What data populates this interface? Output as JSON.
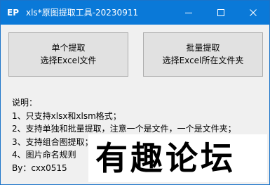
{
  "window": {
    "app_icon_text": "EP",
    "title": "xls*原图提取工具-20230911",
    "controls": {
      "minimize_icon": "minimize-icon",
      "maximize_icon": "maximize-icon",
      "close_icon": "close-icon"
    },
    "accent_color": "#0a79d8"
  },
  "buttons": {
    "single": {
      "line1": "单个提取",
      "line2": "选择Excel文件"
    },
    "batch": {
      "line1": "批量提取",
      "line2": "选择Excel所在文件夹"
    }
  },
  "instructions": {
    "heading": "说明：",
    "lines": [
      "1、只支持xlsx和xlsm格式；",
      "2、支持单独和批量提取，注意一个是文件，一个是文件夹；",
      "3、支持组合图提取；",
      "4、图片命名规则",
      "By：cxx0515"
    ]
  },
  "watermark": {
    "text": "有趣论坛"
  }
}
